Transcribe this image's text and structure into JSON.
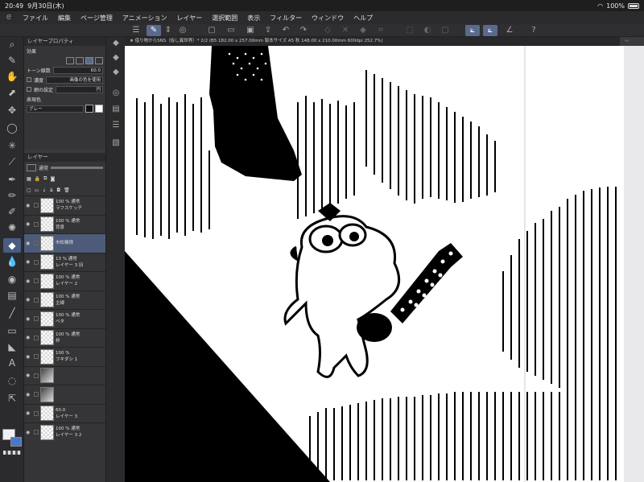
{
  "status": {
    "time": "20:49",
    "date": "9月30日(木)",
    "battery": "100%"
  },
  "menu": {
    "logo_icon": "clip-logo-icon",
    "items": [
      "ファイル",
      "編集",
      "ページ管理",
      "アニメーション",
      "レイヤー",
      "選択範囲",
      "表示",
      "フィルター",
      "ウィンドウ",
      "ヘルプ"
    ]
  },
  "document": {
    "title": "★ 借り物からSNS（仮し異世界）* 2/2 (B5 182.00 x 257.00mm 製本サイズ A5 秋 148.00 x 210.00mm 600dpi 252.7%)"
  },
  "layer_property": {
    "title": "レイヤープロパティ",
    "effect_label": "効果",
    "tone_lines_label": "トーン線数",
    "tone_lines_value": "60.0",
    "density_label": "濃度",
    "density_value": "画像の色を使用",
    "dot_label": "網の設定",
    "dot_value": "円",
    "expression_label": "表現色",
    "expression_value": "グレー"
  },
  "layer_panel": {
    "title": "レイヤー",
    "blend": "通常",
    "layers": [
      {
        "pct": "100 %",
        "mode": "通常",
        "name": "ラフスケッチ",
        "thumb": "checker",
        "sel": false
      },
      {
        "pct": "100 %",
        "mode": "通常",
        "name": "背景",
        "thumb": "checker",
        "sel": false
      },
      {
        "pct": "",
        "mode": "",
        "name": "市松模様",
        "thumb": "checker",
        "sel": true
      },
      {
        "pct": "13 %",
        "mode": "通常",
        "name": "レイヤー 3 旧",
        "thumb": "checker",
        "sel": false
      },
      {
        "pct": "100 %",
        "mode": "通常",
        "name": "レイヤー 2",
        "thumb": "checker",
        "sel": false
      },
      {
        "pct": "100 %",
        "mode": "通常",
        "name": "主線",
        "thumb": "checker",
        "sel": false
      },
      {
        "pct": "100 %",
        "mode": "通常",
        "name": "ベタ",
        "thumb": "checker",
        "sel": false
      },
      {
        "pct": "100 %",
        "mode": "通常",
        "name": "枠",
        "thumb": "checker",
        "sel": false
      },
      {
        "pct": "100 %",
        "mode": "",
        "name": "フキダシ 1",
        "thumb": "checker",
        "sel": false
      },
      {
        "pct": "",
        "mode": "",
        "name": "",
        "thumb": "mix",
        "sel": false
      },
      {
        "pct": "",
        "mode": "",
        "name": "",
        "thumb": "mix",
        "sel": false
      },
      {
        "pct": "60.0",
        "mode": "",
        "name": "レイヤー 3",
        "thumb": "checker",
        "sel": false
      },
      {
        "pct": "100 %",
        "mode": "通常",
        "name": "レイヤー 3 2",
        "thumb": "checker",
        "sel": false
      }
    ]
  }
}
